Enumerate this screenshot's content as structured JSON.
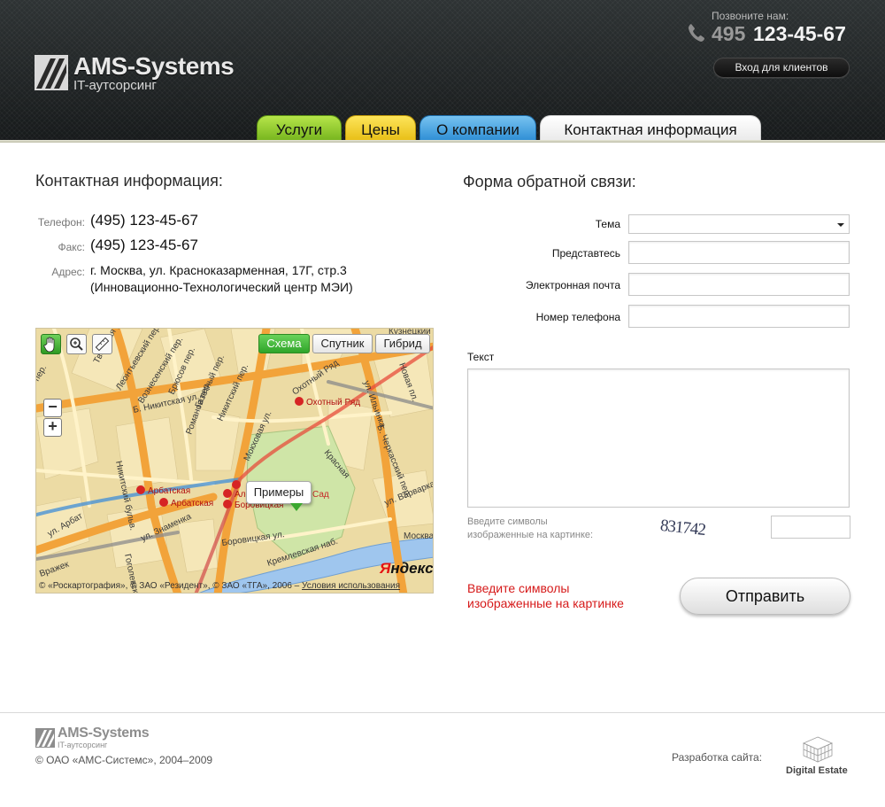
{
  "header": {
    "logo_title": "AMS-Systems",
    "logo_subtitle": "IT-аутсорсинг",
    "call_label": "Позвоните нам:",
    "phone_code": "495",
    "phone_number": "123-45-67",
    "client_login": "Вход для клиентов"
  },
  "nav": {
    "tabs": [
      {
        "label": "Услуги",
        "color": "#8cc63f"
      },
      {
        "label": "Цены",
        "color": "#f2cc2c"
      },
      {
        "label": "О компании",
        "color": "#3a9ae0"
      },
      {
        "label": "Контактная информация",
        "color": "#f3f3f3",
        "active": true
      }
    ]
  },
  "contacts": {
    "title": "Контактная информация:",
    "phone_label": "Телефон:",
    "phone_value": "(495) 123-45-67",
    "fax_label": "Факс:",
    "fax_value": "(495) 123-45-67",
    "address_label": "Адрес:",
    "address_line1": "г. Москва, ул. Красноказарменная, 17Г, стр.3",
    "address_line2": "(Инновационно-Технологический центр МЭИ)"
  },
  "map": {
    "types": [
      "Схема",
      "Спутник",
      "Гибрид"
    ],
    "active_type": "Схема",
    "zoom_out": "−",
    "zoom_in": "+",
    "balloon": "Примеры",
    "brand_y": "Я",
    "brand_rest": "ндекс",
    "copyright": "© «Роскартография», © ЗАО «Резидент», © ЗАО «ТГА», 2006 –",
    "terms_link": "Условия использования",
    "streets": [
      "Тверская ул.",
      "Леонтьевский пер.",
      "Вознесенский пер.",
      "Брюсов пер.",
      "Газетный пер.",
      "Никитский пер.",
      "Охотный Ряд",
      "Мокховая ул.",
      "Б. Никитская ул.",
      "Никитский бульв.",
      "Красная",
      "ул. Знаменка",
      "Боровицкая ул.",
      "Кремлевская наб.",
      "Москва",
      "Гоголевский бульв.",
      "ул. Арбат",
      "ул. Варварка",
      "Новая пл.",
      "ул. Ильинка",
      "Кузнецкий",
      "Романов пер.",
      "пер.",
      "Вражек",
      "Б. Черкасский пер.",
      "Сад"
    ],
    "metro": [
      "Охотный Ряд",
      "Арбатская",
      "Арбатская",
      "Боровицкая",
      "Алек"
    ]
  },
  "form": {
    "title": "Форма обратной связи:",
    "topic_label": "Тема",
    "topic_value": "",
    "name_label": "Представтесь",
    "email_label": "Электронная почта",
    "phone_label": "Номер телефона",
    "text_label": "Текст",
    "captcha_hint_line1": "Введите символы",
    "captcha_hint_line2": "изображенные на картинке:",
    "captcha_code": "831742",
    "error_line1": "Введите символы",
    "error_line2": "изображенные на картинке",
    "submit_label": "Отправить"
  },
  "footer": {
    "logo_title": "AMS-Systems",
    "logo_subtitle": "IT-аутсорсинг",
    "copyright": "© ОАО «АМС-Системс», 2004–2009",
    "dev_label": "Разработка сайта:",
    "dev_brand": "Digital Estate"
  }
}
